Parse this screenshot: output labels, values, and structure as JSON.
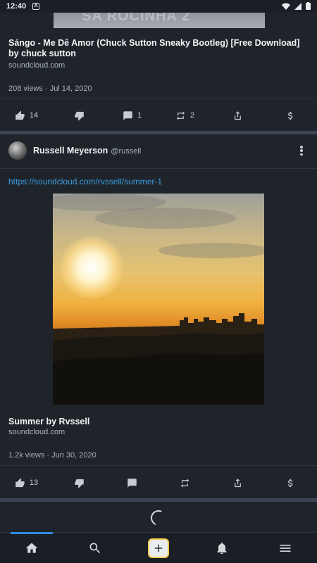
{
  "status_bar": {
    "time": "12:40",
    "notification_icon": "A"
  },
  "post1": {
    "thumbnail_watermark": "SA ROCINHA 2",
    "title": "Sángo - Me Dê Amor (Chuck Sutton Sneaky Bootleg) [Free Download] by chuck sutton",
    "domain": "soundcloud.com",
    "meta": "208 views · Jul 14, 2020",
    "actions": {
      "likes": "14",
      "comments": "1",
      "reposts": "2"
    }
  },
  "post2": {
    "author_name": "Russell Meyerson",
    "author_handle": "@russell",
    "link": "https://soundcloud.com/rvssell/summer-1",
    "title": "Summer by Rvssell",
    "domain": "soundcloud.com",
    "meta": "1.2k views · Jun 30, 2020",
    "actions": {
      "likes": "13"
    }
  },
  "nav": {
    "items": [
      "home-icon",
      "search-icon",
      "compose-icon",
      "bell-icon",
      "menu-icon"
    ],
    "active": "home"
  },
  "colors": {
    "background": "#1f242b",
    "link": "#3a9de0",
    "accent": "#2f8ae0",
    "compose_border": "#f2c94c"
  }
}
